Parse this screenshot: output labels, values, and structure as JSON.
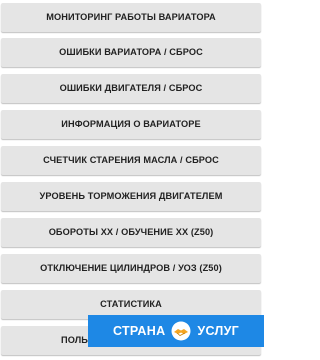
{
  "menu": {
    "items": [
      {
        "label": "МОНИТОРИНГ РАБОТЫ ВАРИАТОРА"
      },
      {
        "label": "ОШИБКИ ВАРИАТОРА / СБРОС"
      },
      {
        "label": "ОШИБКИ ДВИГАТЕЛЯ / СБРОС"
      },
      {
        "label": "ИНФОРМАЦИЯ О ВАРИАТОРЕ"
      },
      {
        "label": "СЧЕТЧИК СТАРЕНИЯ МАСЛА / СБРОС"
      },
      {
        "label": "УРОВЕНЬ ТОРМОЖЕНИЯ ДВИГАТЕЛЕМ"
      },
      {
        "label": "ОБОРОТЫ ХХ / ОБУЧЕНИЕ ХХ (Z50)"
      },
      {
        "label": "ОТКЛЮЧЕНИЕ ЦИЛИНДРОВ / УОЗ (Z50)"
      },
      {
        "label": "СТАТИСТИКА"
      },
      {
        "label": "ПОЛЬЗО"
      }
    ]
  },
  "watermark": {
    "text_left": "СТРАНА",
    "text_right": "УСЛУГ",
    "logo_icon": "handshake-icon",
    "background": "#1e88e5"
  },
  "colors": {
    "button_bg": "#e5e5e5",
    "button_text": "#222222"
  }
}
